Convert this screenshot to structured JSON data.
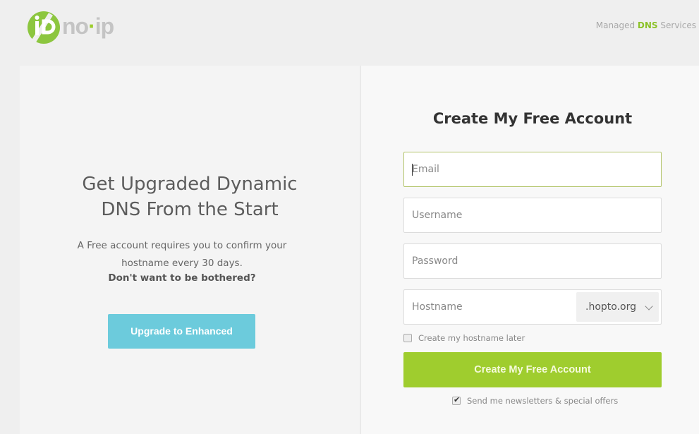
{
  "header": {
    "logo_text": {
      "pre": "no",
      "dot": "·",
      "post": "ip"
    },
    "logo_icon": "noip-logo-icon",
    "tagline": {
      "pre": "Managed",
      "highlight": "DNS",
      "post": "Services"
    }
  },
  "promo": {
    "title_line1": "Get Upgraded Dynamic",
    "title_line2": "DNS From the Start",
    "text_line1": "A Free account requires you to confirm your",
    "text_line2": "hostname every 30 days.",
    "bold_text": "Don't want to be bothered?",
    "upgrade_button": "Upgrade to Enhanced"
  },
  "form": {
    "title": "Create My Free Account",
    "email": {
      "placeholder": "Email",
      "value": ""
    },
    "username": {
      "placeholder": "Username",
      "value": ""
    },
    "password": {
      "placeholder": "Password",
      "value": ""
    },
    "hostname": {
      "placeholder": "Hostname",
      "value": ""
    },
    "domain_select": {
      "selected": ".hopto.org",
      "icon": "chevron-down-icon"
    },
    "hostname_later": {
      "label": "Create my hostname later",
      "checked": false
    },
    "submit_button": "Create My Free Account",
    "newsletter": {
      "label": "Send me newsletters & special offers",
      "checked": true
    }
  },
  "colors": {
    "brand_green": "#9fcd2e",
    "upgrade_blue": "#6ccbdc",
    "focus_border": "#b3c46a"
  }
}
